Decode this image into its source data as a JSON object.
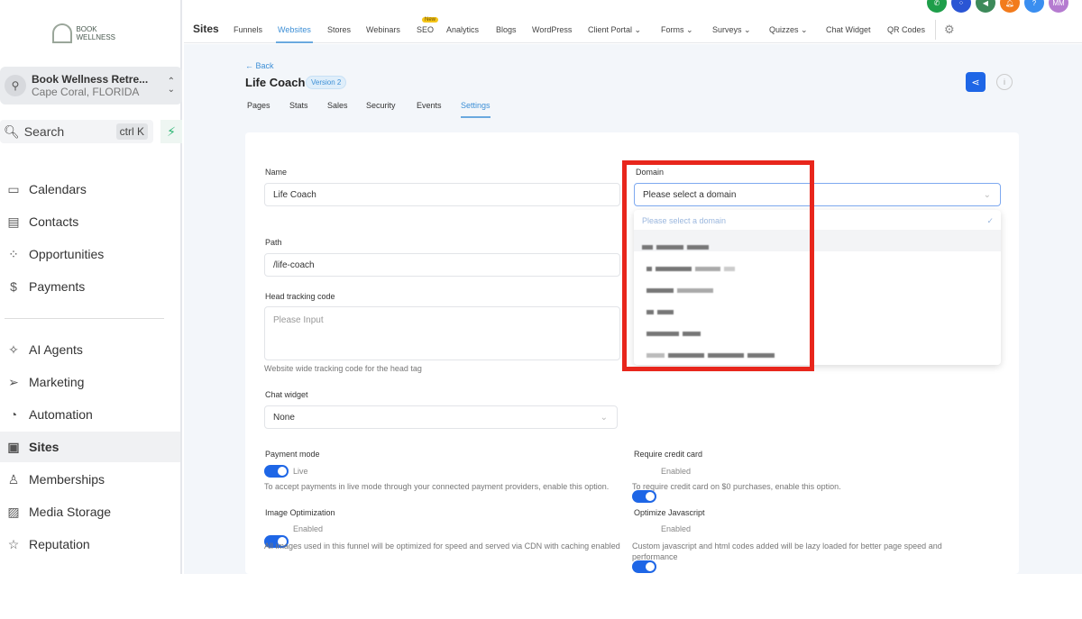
{
  "sidebar": {
    "logo_text": "BOOK WELLNESS",
    "location_name": "Book Wellness Retre...",
    "location_sub": "Cape Coral, FLORIDA",
    "search": "Search",
    "shortcut": "ctrl K",
    "items": [
      {
        "label": "Calendars",
        "icon": "calendar-icon"
      },
      {
        "label": "Contacts",
        "icon": "contacts-icon"
      },
      {
        "label": "Opportunities",
        "icon": "opportunities-icon"
      },
      {
        "label": "Payments",
        "icon": "payments-icon"
      },
      {
        "label": "AI Agents",
        "icon": "sparkle-icon"
      },
      {
        "label": "Marketing",
        "icon": "send-icon"
      },
      {
        "label": "Automation",
        "icon": "automation-icon"
      },
      {
        "label": "Sites",
        "icon": "sites-icon"
      },
      {
        "label": "Memberships",
        "icon": "memberships-icon"
      },
      {
        "label": "Media Storage",
        "icon": "image-icon"
      },
      {
        "label": "Reputation",
        "icon": "star-icon"
      }
    ]
  },
  "topnav": {
    "section": "Sites",
    "tabs": [
      "Funnels",
      "Websites",
      "Stores",
      "Webinars",
      "SEO",
      "Analytics",
      "Blogs",
      "WordPress",
      "Client Portal",
      "Forms",
      "Surveys",
      "Quizzes",
      "Chat Widget",
      "QR Codes"
    ],
    "new_badge": "New",
    "active": "Websites",
    "avatar": "MM"
  },
  "page": {
    "back": "← Back",
    "title": "Life Coach",
    "version": "Version 2",
    "tabs": [
      "Pages",
      "Stats",
      "Sales",
      "Security",
      "Events",
      "Settings"
    ],
    "active_tab": "Settings"
  },
  "form": {
    "name_label": "Name",
    "name_value": "Life Coach",
    "path_label": "Path",
    "path_value": "/life-coach",
    "head_label": "Head tracking code",
    "head_placeholder": "Please Input",
    "head_help": "Website wide tracking code for the head tag",
    "chat_label": "Chat widget",
    "chat_value": "None",
    "domain_label": "Domain",
    "domain_placeholder": "Please select a domain",
    "domain_option_placeholder": "Please select a domain",
    "payment_label": "Payment mode",
    "payment_state": "Live",
    "payment_help": "To accept payments in live mode through your connected payment providers, enable this option.",
    "credit_label": "Require credit card",
    "credit_state": "Enabled",
    "credit_help": "To require credit card on $0 purchases, enable this option.",
    "img_label": "Image Optimization",
    "img_state": "Enabled",
    "img_help": "All images used in this funnel will be optimized for speed and served via CDN with caching enabled",
    "js_label": "Optimize Javascript",
    "js_state": "Enabled",
    "js_help": "Custom javascript and html codes added will be lazy loaded for better page speed and performance"
  },
  "colors": {
    "accent": "#1e66e6",
    "highlight": "#e8261c"
  }
}
